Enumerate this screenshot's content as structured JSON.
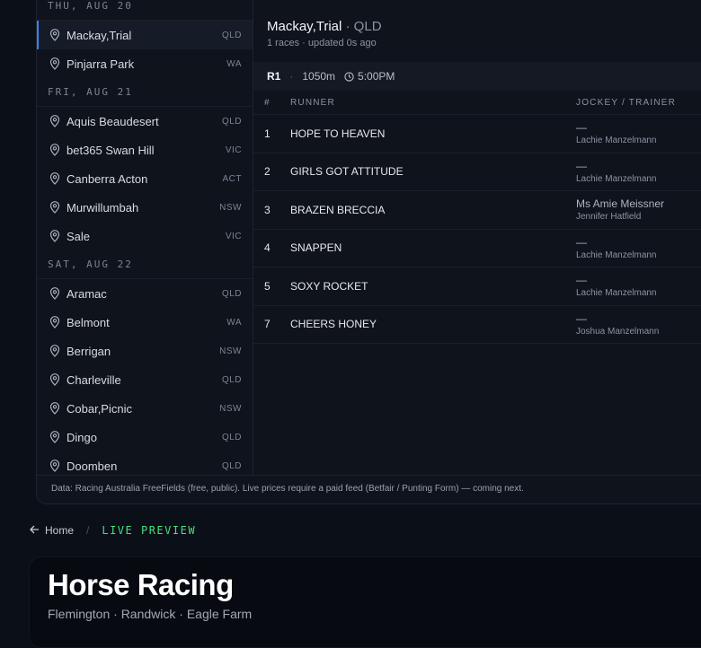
{
  "days": [
    {
      "label": "THU, AUG 20",
      "venues": [
        {
          "name": "Mackay,Trial",
          "state": "QLD",
          "active": true
        },
        {
          "name": "Pinjarra Park",
          "state": "WA"
        }
      ]
    },
    {
      "label": "FRI, AUG 21",
      "venues": [
        {
          "name": "Aquis Beaudesert",
          "state": "QLD"
        },
        {
          "name": "bet365 Swan Hill",
          "state": "VIC"
        },
        {
          "name": "Canberra Acton",
          "state": "ACT"
        },
        {
          "name": "Murwillumbah",
          "state": "NSW"
        },
        {
          "name": "Sale",
          "state": "VIC"
        }
      ]
    },
    {
      "label": "SAT, AUG 22",
      "venues": [
        {
          "name": "Aramac",
          "state": "QLD"
        },
        {
          "name": "Belmont",
          "state": "WA"
        },
        {
          "name": "Berrigan",
          "state": "NSW"
        },
        {
          "name": "Charleville",
          "state": "QLD"
        },
        {
          "name": "Cobar,Picnic",
          "state": "NSW"
        },
        {
          "name": "Dingo",
          "state": "QLD"
        },
        {
          "name": "Doomben",
          "state": "QLD"
        }
      ]
    }
  ],
  "meeting": {
    "title": "Mackay,Trial",
    "state_suffix": "· QLD",
    "subtitle": "1 races · updated 0s ago"
  },
  "race": {
    "number": "R1",
    "distance": "1050m",
    "time": "5:00PM"
  },
  "table": {
    "headers": {
      "num": "#",
      "runner": "RUNNER",
      "jockey_trainer": "JOCKEY / TRAINER"
    },
    "rows": [
      {
        "num": "1",
        "runner": "HOPE TO HEAVEN",
        "jockey": "—",
        "trainer": "Lachie Manzelmann"
      },
      {
        "num": "2",
        "runner": "GIRLS GOT ATTITUDE",
        "jockey": "—",
        "trainer": "Lachie Manzelmann"
      },
      {
        "num": "3",
        "runner": "BRAZEN BRECCIA",
        "jockey": "Ms Amie Meissner",
        "trainer": "Jennifer Hatfield"
      },
      {
        "num": "4",
        "runner": "SNAPPEN",
        "jockey": "—",
        "trainer": "Lachie Manzelmann"
      },
      {
        "num": "5",
        "runner": "SOXY ROCKET",
        "jockey": "—",
        "trainer": "Lachie Manzelmann"
      },
      {
        "num": "7",
        "runner": "CHEERS HONEY",
        "jockey": "—",
        "trainer": "Joshua Manzelmann"
      }
    ]
  },
  "footnote": "Data: Racing Australia FreeFields (free, public). Live prices require a paid feed (Betfair / Punting Form) — coming next.",
  "breadcrumb": {
    "home": "Home",
    "separator": "/",
    "current": "LIVE PREVIEW"
  },
  "hero": {
    "title": "Horse Racing",
    "subtitle": "Flemington · Randwick · Eagle Farm"
  },
  "colors": {
    "accent": "#3b82f6",
    "live": "#4ade80",
    "background": "#0b0f17"
  },
  "icons": {
    "venue": "map-pin-icon",
    "time": "clock-icon",
    "back": "arrow-left-icon"
  }
}
